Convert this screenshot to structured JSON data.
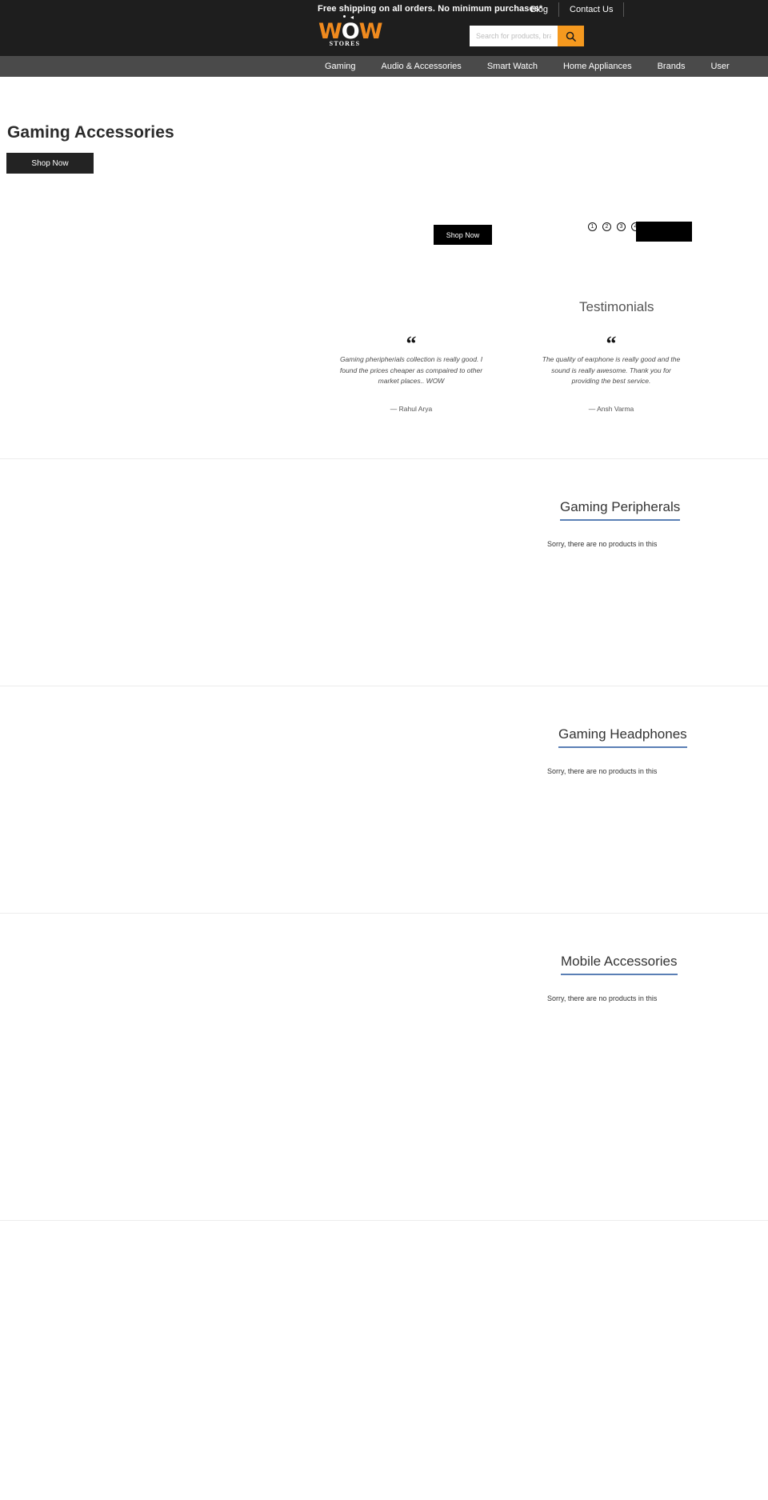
{
  "header": {
    "promo": "Free shipping on all orders. No minimum purchases*",
    "links": [
      {
        "label": "Blog"
      },
      {
        "label": "Contact Us"
      }
    ],
    "logo": {
      "left": "W",
      "middle": "O",
      "right": "W",
      "tagline": "STORES"
    },
    "search": {
      "placeholder": "Search for products, brand",
      "value": "",
      "icon": "search-icon"
    }
  },
  "nav": {
    "items": [
      {
        "label": "Gaming"
      },
      {
        "label": "Audio & Accessories"
      },
      {
        "label": "Smart Watch"
      },
      {
        "label": "Home Appliances"
      },
      {
        "label": "Brands"
      },
      {
        "label": "User"
      }
    ]
  },
  "hero": {
    "title": "Gaming Accessories",
    "cta": "Shop Now"
  },
  "carousel": {
    "cta": "Shop Now",
    "dots": [
      "1",
      "2",
      "3",
      "4"
    ]
  },
  "testimonials": {
    "title": "Testimonials",
    "items": [
      {
        "quote_mark": "“",
        "text": "Gaming pheripherials collection is really good. I found the prices cheaper as compaired to other market places.. WOW",
        "author": "— Rahul Arya"
      },
      {
        "quote_mark": "“",
        "text": "The quality of earphone is really good and the sound is really awesome. Thank you for providing the best service.",
        "author": "— Ansh Varma"
      }
    ]
  },
  "categories": [
    {
      "title": "Gaming Peripherals",
      "empty_message": "Sorry, there are no products in this"
    },
    {
      "title": "Gaming Headphones",
      "empty_message": "Sorry, there are no products in this"
    },
    {
      "title": "Mobile Accessories",
      "empty_message": "Sorry, there are no products in this"
    }
  ],
  "colors": {
    "header_bg": "#1e1e1e",
    "nav_bg": "#4a4a4a",
    "accent_orange": "#f5991f",
    "underline_blue": "#5a7fb5",
    "button_black": "#000000"
  }
}
